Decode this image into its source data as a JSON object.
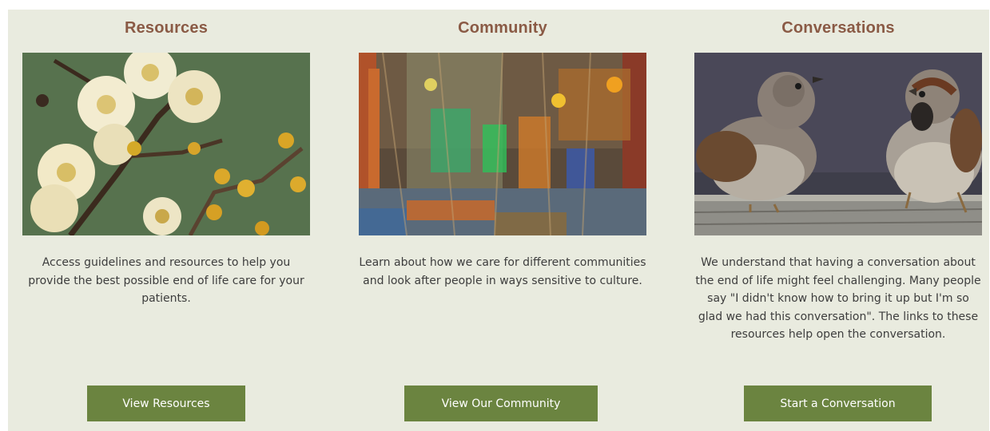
{
  "cards": [
    {
      "title": "Resources",
      "image_alt": "yellow-white-blossoms-photo",
      "description": "Access guidelines and resources to help you provide the best possible end of life care for your patients.",
      "button_label": "View Resources"
    },
    {
      "title": "Community",
      "image_alt": "colorful-woven-installation-photo",
      "description": "Learn about how we care for different communities and look after people in ways sensitive to culture.",
      "button_label": "View Our Community"
    },
    {
      "title": "Conversations",
      "image_alt": "two-sparrows-photo",
      "description": "We understand that having a conversation about the end of life might feel challenging. Many people say \"I didn't know how to bring it up but I'm so glad we had this conversation\". The links to these resources help open the conversation.",
      "button_label": "Start a Conversation"
    }
  ],
  "colors": {
    "panel_background": "#e9ebdf",
    "title": "#8a5a45",
    "button": "#6b8440",
    "button_text": "#ffffff",
    "body_text": "#3d3d3d"
  }
}
